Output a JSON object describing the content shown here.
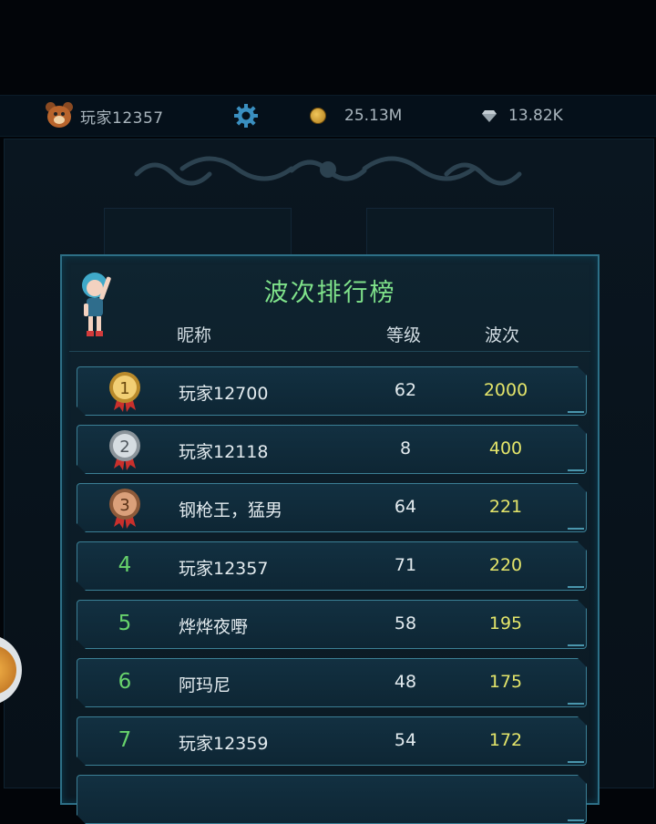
{
  "topbar": {
    "player_name": "玩家12357",
    "avatar_icon": "bear-avatar-icon",
    "settings_icon": "gear-icon",
    "coin_icon": "coin-icon",
    "coins": "25.13M",
    "gem_icon": "diamond-icon",
    "gems": "13.82K"
  },
  "leaderboard": {
    "title": "波次排行榜",
    "columns": {
      "nickname": "昵称",
      "level": "等级",
      "wave": "波次"
    },
    "rows": [
      {
        "rank": "1",
        "medal": "gold",
        "nickname": "玩家12700",
        "level": "62",
        "wave": "2000"
      },
      {
        "rank": "2",
        "medal": "silver",
        "nickname": "玩家12118",
        "level": "8",
        "wave": "400"
      },
      {
        "rank": "3",
        "medal": "bronze",
        "nickname": "钢枪王，猛男",
        "level": "64",
        "wave": "221"
      },
      {
        "rank": "4",
        "medal": "",
        "nickname": "玩家12357",
        "level": "71",
        "wave": "220"
      },
      {
        "rank": "5",
        "medal": "",
        "nickname": "烨烨夜嘢",
        "level": "58",
        "wave": "195"
      },
      {
        "rank": "6",
        "medal": "",
        "nickname": "阿玛尼",
        "level": "48",
        "wave": "175"
      },
      {
        "rank": "7",
        "medal": "",
        "nickname": "玩家12359",
        "level": "54",
        "wave": "172"
      }
    ]
  },
  "colors": {
    "title_green": "#7fe28a",
    "rank_green": "#68d36c",
    "wave_yellow": "#e4e56a",
    "panel_border": "#2d6f86",
    "gold": "#e8b54a",
    "silver": "#b9c2c8",
    "bronze": "#c98a5e"
  }
}
